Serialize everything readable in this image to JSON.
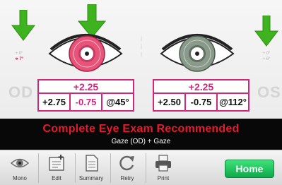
{
  "eyes": {
    "od": {
      "label": "OD",
      "gaze_indicator": {
        "line1": "+ 0°",
        "line2": "➔ 7°"
      },
      "sphere_equivalent": "+2.25",
      "sphere": "+2.75",
      "cylinder": "-0.75",
      "axis": "@45°",
      "iris_color": "#e8537a"
    },
    "os": {
      "label": "OS",
      "gaze_indicator": {
        "line1": "+ 0°",
        "line2": "+ 6°"
      },
      "sphere_equivalent": "+2.25",
      "sphere": "+2.50",
      "cylinder": "-0.75",
      "axis": "@112°",
      "iris_color": "#8a9a8a"
    }
  },
  "banner": {
    "title": "Complete Eye Exam Recommended",
    "subtitle": "Gaze (OD) + Gaze"
  },
  "toolbar": {
    "items": [
      {
        "label": "Mono",
        "icon": "eye-icon"
      },
      {
        "label": "Edit",
        "icon": "edit-icon"
      },
      {
        "label": "Summary",
        "icon": "document-icon"
      },
      {
        "label": "Retry",
        "icon": "retry-icon"
      },
      {
        "label": "Print",
        "icon": "printer-icon"
      }
    ],
    "home_label": "Home"
  },
  "colors": {
    "accent": "#d1267a",
    "warning": "#e41b2e",
    "arrow": "#3fb21f",
    "home": "#18b755"
  }
}
